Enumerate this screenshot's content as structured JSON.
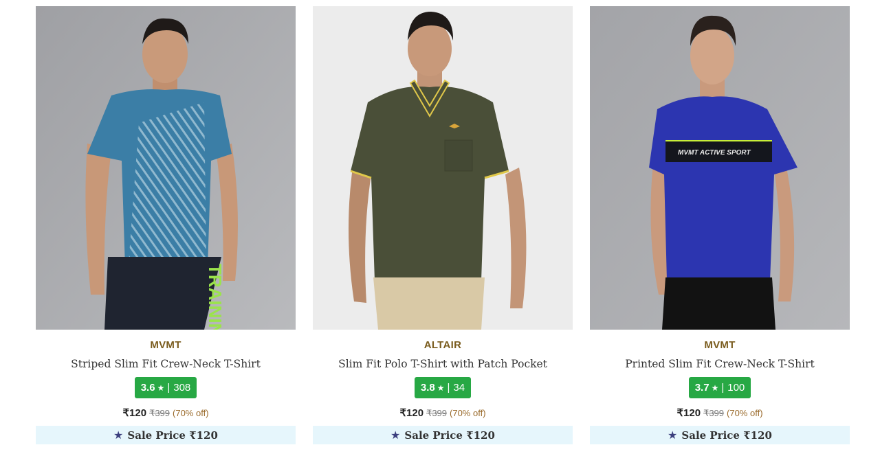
{
  "products": [
    {
      "brand": "MVMT",
      "name": "Striped Slim Fit Crew-Neck T-Shirt",
      "rating": "3.6",
      "rating_star": "★",
      "rating_sep": "|",
      "reviews": "308",
      "price": "₹120",
      "mrp": "₹399",
      "discount": "(70% off)",
      "sale_label": "Sale Price ₹120",
      "image_icon": "model-striped-tshirt-image",
      "colors": {
        "bg": "#a7a8ab",
        "shirt": "#3b7ea6",
        "pants": "#1f2430",
        "accent": "#9be34c"
      },
      "shorts_text": "TRAINING"
    },
    {
      "brand": "ALTAIR",
      "name": "Slim Fit Polo T-Shirt with Patch Pocket",
      "rating": "3.8",
      "rating_star": "★",
      "rating_sep": "|",
      "reviews": "34",
      "price": "₹120",
      "mrp": "₹399",
      "discount": "(70% off)",
      "sale_label": "Sale Price ₹120",
      "image_icon": "model-polo-tshirt-image",
      "colors": {
        "bg": "#ebebeb",
        "shirt": "#4a4f38",
        "pants": "#d9c9a6",
        "accent": "#e0c84a"
      }
    },
    {
      "brand": "MVMT",
      "name": "Printed Slim Fit Crew-Neck T-Shirt",
      "rating": "3.7",
      "rating_star": "★",
      "rating_sep": "|",
      "reviews": "100",
      "price": "₹120",
      "mrp": "₹399",
      "discount": "(70% off)",
      "sale_label": "Sale Price ₹120",
      "image_icon": "model-printed-tshirt-image",
      "colors": {
        "bg": "#a9aaad",
        "shirt": "#2c35b0",
        "pants": "#121212",
        "accent": "#c8ef3a"
      },
      "chest_text": "MVMT ACTIVE SPORT"
    }
  ]
}
